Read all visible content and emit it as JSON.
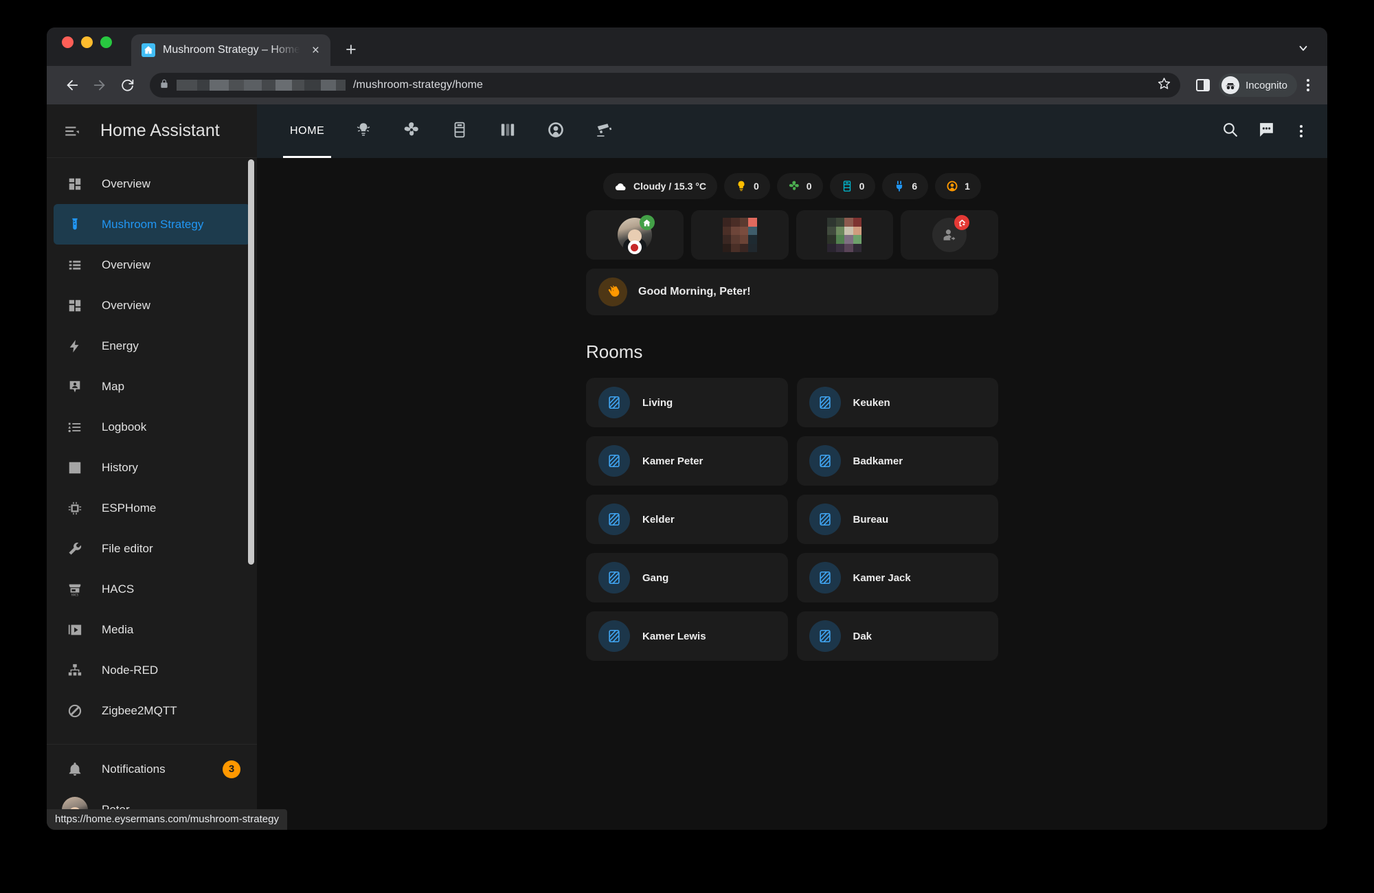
{
  "browser": {
    "tab": {
      "title": "Mushroom Strategy – Home As",
      "favicon": "home-assistant-logo",
      "close_label": "×"
    },
    "new_tab_label": "+",
    "tab_search_icon": "chevron-down-icon",
    "nav": {
      "back": "back-icon",
      "forward": "forward-icon",
      "reload": "reload-icon"
    },
    "omnibox": {
      "lock_icon": "lock-icon",
      "url_visible": "/mushroom-strategy/home",
      "url_redacted": true,
      "star_icon": "bookmark-star-icon"
    },
    "side_panel_icon": "side-panel-icon",
    "profile": {
      "label": "Incognito",
      "icon": "incognito-icon"
    },
    "menu_icon": "three-dot-menu-icon",
    "status_url": "https://home.eysermans.com/mushroom-strategy"
  },
  "sidebar": {
    "title": "Home Assistant",
    "menu_icon": "collapse-menu-icon",
    "items": [
      {
        "label": "Overview",
        "icon": "view-dashboard-icon",
        "active": false
      },
      {
        "label": "Mushroom Strategy",
        "icon": "test-tube-icon",
        "active": true
      },
      {
        "label": "Overview",
        "icon": "view-list-icon",
        "active": false
      },
      {
        "label": "Overview",
        "icon": "view-dashboard-icon",
        "active": false
      },
      {
        "label": "Energy",
        "icon": "lightning-bolt-icon",
        "active": false
      },
      {
        "label": "Map",
        "icon": "map-marker-account-icon",
        "active": false
      },
      {
        "label": "Logbook",
        "icon": "format-list-bulleted-icon",
        "active": false
      },
      {
        "label": "History",
        "icon": "chart-box-icon",
        "active": false
      },
      {
        "label": "ESPHome",
        "icon": "chip-icon",
        "active": false
      },
      {
        "label": "File editor",
        "icon": "wrench-icon",
        "active": false
      },
      {
        "label": "HACS",
        "icon": "hacs-store-icon",
        "active": false
      },
      {
        "label": "Media",
        "icon": "play-box-multiple-icon",
        "active": false
      },
      {
        "label": "Node-RED",
        "icon": "sitemap-icon",
        "active": false
      },
      {
        "label": "Zigbee2MQTT",
        "icon": "zigbee-icon",
        "active": false
      }
    ],
    "notifications": {
      "label": "Notifications",
      "icon": "bell-icon",
      "count": "3"
    },
    "user": {
      "label": "Peter",
      "icon": "user-avatar"
    }
  },
  "ha_toolbar": {
    "tabs": [
      {
        "label": "HOME",
        "icon": null,
        "active": true
      },
      {
        "label": "",
        "icon": "lightbulb-group-icon",
        "active": false
      },
      {
        "label": "",
        "icon": "fan-icon",
        "active": false
      },
      {
        "label": "",
        "icon": "appliance-icon",
        "active": false
      },
      {
        "label": "",
        "icon": "blinds-icon",
        "active": false
      },
      {
        "label": "",
        "icon": "speaker-gauge-icon",
        "active": false
      },
      {
        "label": "",
        "icon": "cctv-camera-icon",
        "active": false
      }
    ],
    "actions": [
      {
        "name": "search-icon",
        "label": ""
      },
      {
        "name": "assist-chat-icon",
        "label": ""
      },
      {
        "name": "overflow-menu-icon",
        "label": ""
      }
    ]
  },
  "chips": [
    {
      "icon": "weather-cloudy-icon",
      "label": "Cloudy / 15.3 °C",
      "color": "#ffffff"
    },
    {
      "icon": "lightbulb-icon",
      "label": "0",
      "color": "#ffbe00"
    },
    {
      "icon": "fan-icon",
      "label": "0",
      "color": "#4caf50"
    },
    {
      "icon": "appliance-icon",
      "label": "0",
      "color": "#00bcd4"
    },
    {
      "icon": "power-plug-icon",
      "label": "6",
      "color": "#2196f3"
    },
    {
      "icon": "speaker-icon",
      "label": "1",
      "color": "#ff9800"
    }
  ],
  "persons": [
    {
      "type": "photo",
      "badge": "home",
      "badge_icon": "home-icon",
      "extra_badge": "target-icon"
    },
    {
      "type": "blurred",
      "palette": [
        "#3a2420",
        "#4a2d26",
        "#5b3a30",
        "#e06a5e",
        "#4b2f27",
        "#6d4539",
        "#7a4c3e",
        "#3f5d6b",
        "#3a2722",
        "#5a3a30",
        "#6b4336",
        "#1e2a31",
        "#2a1d19",
        "#4a2f27",
        "#3a2622",
        "#20282e"
      ]
    },
    {
      "type": "blurred",
      "palette": [
        "#2e3630",
        "#3c4738",
        "#8c5a4e",
        "#7e3230",
        "#404a3d",
        "#6d8a5e",
        "#c9c1ae",
        "#d09c7e",
        "#2c3329",
        "#52804f",
        "#7f6f82",
        "#6ea06b",
        "#2a2430",
        "#3a3040",
        "#5a4458",
        "#302a36"
      ]
    },
    {
      "type": "ghost",
      "badge": "away",
      "badge_icon": "home-exit-icon",
      "icon": "account-arrow-right-icon"
    }
  ],
  "greeting": {
    "icon": "waving-hand-icon",
    "text": "Good Morning, Peter!"
  },
  "rooms_section": {
    "title": "Rooms"
  },
  "rooms": [
    {
      "name": "Living",
      "icon": "texture-box-icon"
    },
    {
      "name": "Keuken",
      "icon": "texture-box-icon"
    },
    {
      "name": "Kamer Peter",
      "icon": "texture-box-icon"
    },
    {
      "name": "Badkamer",
      "icon": "texture-box-icon"
    },
    {
      "name": "Kelder",
      "icon": "texture-box-icon"
    },
    {
      "name": "Bureau",
      "icon": "texture-box-icon"
    },
    {
      "name": "Gang",
      "icon": "texture-box-icon"
    },
    {
      "name": "Kamer Jack",
      "icon": "texture-box-icon"
    },
    {
      "name": "Kamer Lewis",
      "icon": "texture-box-icon"
    },
    {
      "name": "Dak",
      "icon": "texture-box-icon"
    }
  ],
  "colors": {
    "accent": "#2196f3",
    "sidebar_bg": "#1c1c1c",
    "card_bg": "#1c1c1c",
    "toolbar_bg": "#1b2227",
    "badge": "#ff9800"
  }
}
